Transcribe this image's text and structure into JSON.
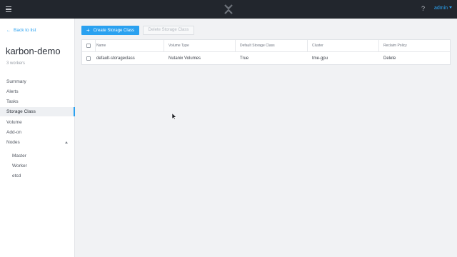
{
  "topbar": {
    "help_label": "?",
    "user_label": "admin",
    "icons": [
      "menu-icon",
      "nutanix-x-logo",
      "caret-down-icon"
    ]
  },
  "sidebar": {
    "back_label": "Back to list",
    "cluster_name": "karbon-demo",
    "workers_label": "3 workers",
    "items": [
      {
        "label": "Summary"
      },
      {
        "label": "Alerts"
      },
      {
        "label": "Tasks"
      },
      {
        "label": "Storage Class",
        "active": true
      },
      {
        "label": "Volume"
      },
      {
        "label": "Add-on"
      },
      {
        "label": "Nodes",
        "expanded": true
      }
    ],
    "sub_items": [
      {
        "label": "Master"
      },
      {
        "label": "Worker"
      },
      {
        "label": "etcd"
      }
    ]
  },
  "toolbar": {
    "create_label": "Create Storage Class",
    "delete_label": "Delete Storage Class"
  },
  "table": {
    "columns": [
      "Name",
      "Volume Type",
      "Default Storage Class",
      "Cluster",
      "Reclaim Policy"
    ],
    "rows": [
      [
        "default-storageclass",
        "Nutanix Volumes",
        "True",
        "tme-gpu",
        "Delete"
      ]
    ]
  },
  "colors": {
    "accent": "#2aa1f0",
    "topbar": "#22262d",
    "background": "#f1f2f4"
  }
}
